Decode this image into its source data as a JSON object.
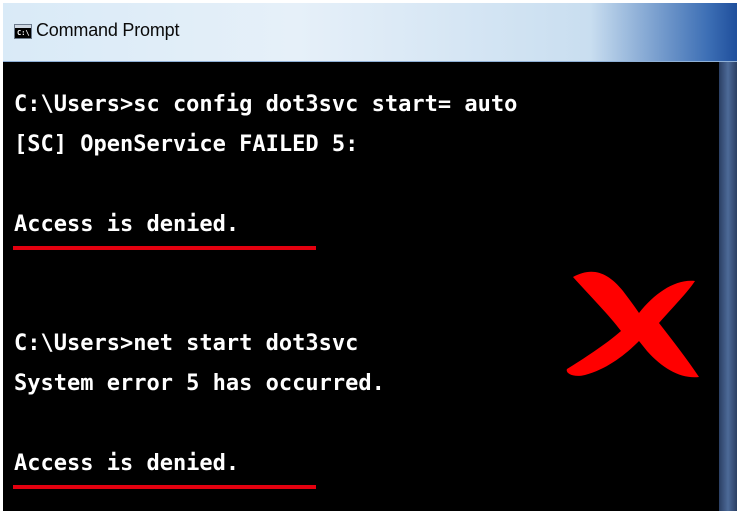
{
  "window": {
    "title": "Command Prompt",
    "icon": "cmd-window-icon",
    "icon_glyph": "C:\\"
  },
  "console": {
    "lines": [
      "C:\\Users>sc config dot3svc start= auto",
      "[SC] OpenService FAILED 5:",
      "",
      "Access is denied.",
      "",
      "",
      "C:\\Users>net start dot3svc",
      "System error 5 has occurred.",
      "",
      "Access is denied."
    ]
  },
  "annotations": {
    "underline_color": "#e4000f",
    "x_mark_icon": "red-x-icon",
    "x_mark_color": "#ff0000"
  },
  "colors": {
    "console_background": "#000000",
    "console_text": "#ffffff",
    "titlebar_accent": "#1f4f9c"
  }
}
